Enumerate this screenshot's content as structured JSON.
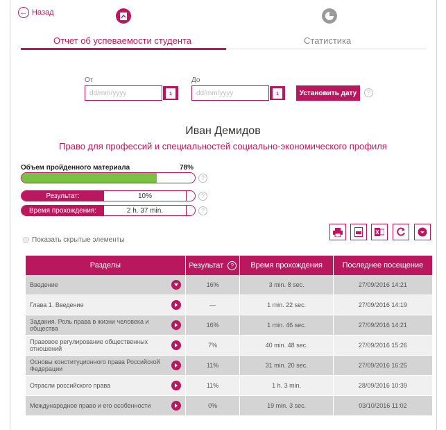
{
  "nav": {
    "back_label": "Назад"
  },
  "tabs": [
    {
      "label": "Отчет об успеваемости студента",
      "active": true,
      "icon": "report-icon"
    },
    {
      "label": "Статистика",
      "active": false,
      "icon": "pie-chart-icon"
    }
  ],
  "date_filter": {
    "from_label": "От",
    "to_label": "До",
    "from_placeholder": "dd/mm/yyyy",
    "to_placeholder": "dd/mm/yyyy",
    "calendar_day": "1",
    "set_button": "Установить дату",
    "help": "?"
  },
  "student": {
    "name": "Иван Демидов",
    "course": "Право для профессий и специальностей социально-экономического профиля"
  },
  "progress": {
    "label": "Объем пройденного материала",
    "percent_text": "78%",
    "value": 0.78
  },
  "stats": [
    {
      "key": "Результат:",
      "value": "10%"
    },
    {
      "key": "Время прохождения:",
      "value": "2 h. 37 min."
    }
  ],
  "show_hidden_label": "Показать скрытые элементы",
  "toolbar": [
    "print-icon",
    "pdf-icon",
    "excel-icon",
    "refresh-icon",
    "dropdown-icon"
  ],
  "table": {
    "headers": [
      "Разделы",
      "Результат",
      "Время прохождения",
      "Последнее посещение"
    ],
    "rows": [
      {
        "section": "Введение",
        "result": "16%",
        "time": "3 min. 8 sec.",
        "last": "27/09/2016 14:21",
        "expanded": true
      },
      {
        "section": "Глава 1. Введение",
        "result": "—",
        "time": "1 min. 22 sec.",
        "last": "27/09/2016 14:19",
        "expanded": false
      },
      {
        "section": "Задания. Роль права в жизни человека и общества",
        "result": "16%",
        "time": "1 min. 46 sec.",
        "last": "27/09/2016 14:21",
        "expanded": false
      },
      {
        "section": "Правовое регулирование общественных отношений",
        "result": "7%",
        "time": "40 min. 48 sec.",
        "last": "27/09/2016 15:26",
        "expanded": false
      },
      {
        "section": "Основы конституционного права Российской Федерации",
        "result": "11%",
        "time": "31 min. 20 sec.",
        "last": "27/09/2016 16:25",
        "expanded": false
      },
      {
        "section": "Отрасли российского права",
        "result": "11%",
        "time": "1 h. 3 min.",
        "last": "28/09/2016 10:39",
        "expanded": false
      },
      {
        "section": "Международное право и его особенности",
        "result": "0%",
        "time": "19 min. 3 sec.",
        "last": "03/10/2016 11:02",
        "expanded": false
      }
    ]
  },
  "colors": {
    "accent": "#b9185e",
    "progress_fill": "#7ac143",
    "row_dark": "#d4d4d4",
    "row_light": "#f0f0f0"
  }
}
